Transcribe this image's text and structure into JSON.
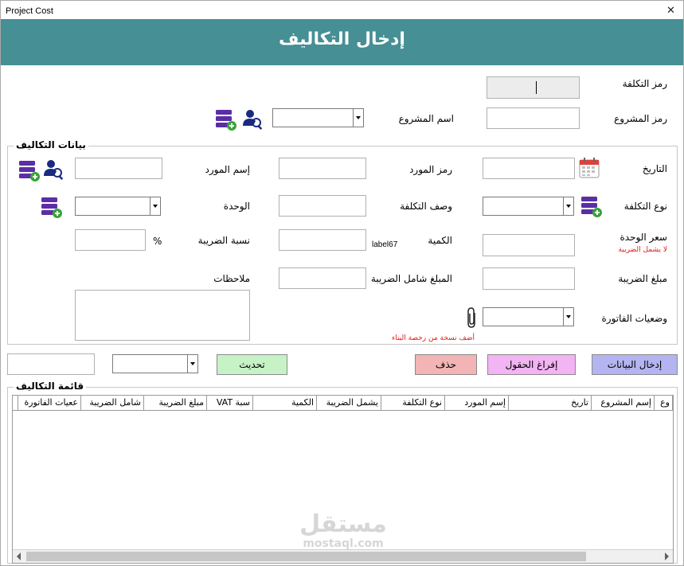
{
  "window": {
    "title": "Project Cost",
    "close_glyph": "✕"
  },
  "header": {
    "title": "إدخال التكاليف",
    "bg_color": "#468f94"
  },
  "top": {
    "cost_code_label": "رمز التكلفة",
    "cost_code_value": "",
    "project_code_label": "رمز المشروع",
    "project_name_label": "اسم المشروع"
  },
  "cost_data": {
    "frame_title": "بيانات التكاليف",
    "date_label": "التاريخ",
    "supplier_code_label": "رمز المورد",
    "supplier_name_label": "إسم المورد",
    "cost_type_label": "نوع التكلفة",
    "cost_desc_label": "وصف التكلفة",
    "unit_label": "الوحدة",
    "unit_price_label": "سعر الوحدة",
    "unit_price_note": "لا يشمل الضريبة",
    "quantity_label": "الكمية",
    "label67": "label67",
    "tax_rate_label": "نسبة الضريبة",
    "percent_sign": "%",
    "tax_amount_label": "مبلغ الضريبة",
    "total_incl_tax_label": "المبلغ شامل الضريبة",
    "notes_label": "ملاحظات",
    "invoice_status_label": "وضعيات الفاتورة",
    "attach_note": "أضف نسخة من رخصة البناء"
  },
  "buttons": {
    "enter_data": "إدخال البيانات",
    "clear_fields": "إفراغ الحقول",
    "delete": "حذف",
    "update": "تحديث"
  },
  "colors": {
    "enter_data_bg": "#b4b4f0",
    "clear_fields_bg": "#f2b4f2",
    "delete_bg": "#f2b4b4",
    "update_bg": "#c6f2c6",
    "accent_purple": "#5b2ea6",
    "note_red": "#e01b1b"
  },
  "cost_list": {
    "frame_title": "قائمة التكاليف",
    "columns": [
      "وع",
      "إسم المشروع",
      "تاريخ",
      "إسم المورد",
      "نوع التكلفة",
      "يشمل الضريبة",
      "الكمية",
      "سبة VAT",
      "مبلغ الضريبة",
      "شامل الضريبة",
      "ععيات الفاتورة"
    ]
  },
  "watermark": {
    "arabic": "مستقل",
    "latin": "mostaql.com"
  },
  "icons": {
    "add_db": "database-plus-icon",
    "search_user": "user-search-icon",
    "calendar": "calendar-icon",
    "paperclip": "paperclip-icon"
  }
}
